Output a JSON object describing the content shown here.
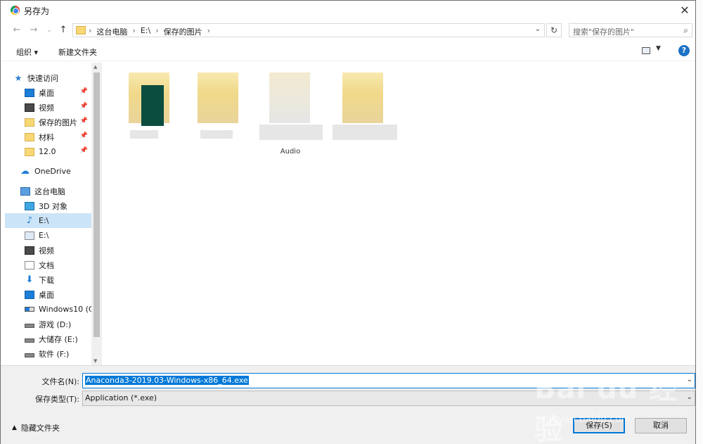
{
  "window": {
    "title": "另存为",
    "close_label": "✕"
  },
  "address": {
    "crumbs": [
      "这台电脑",
      "E:\\",
      "保存的图片"
    ],
    "search_placeholder": "搜索\"保存的图片\""
  },
  "toolbar": {
    "organize": "组织 ▾",
    "new_folder": "新建文件夹",
    "help": "?"
  },
  "nav": {
    "quick_access": "快速访问",
    "quick_items": [
      {
        "label": "桌面",
        "icon": "desktop-icon"
      },
      {
        "label": "视频",
        "icon": "video-icon"
      },
      {
        "label": "保存的图片",
        "icon": "folder-icon"
      },
      {
        "label": "材料",
        "icon": "folder-icon"
      },
      {
        "label": "12.0",
        "icon": "folder-icon"
      }
    ],
    "onedrive": "OneDrive",
    "this_pc": "这台电脑",
    "pc_items": [
      {
        "label": "3D 对象",
        "icon": "3d-objects-icon"
      },
      {
        "label": "E:\\",
        "icon": "music-icon",
        "selected": true
      },
      {
        "label": "E:\\",
        "icon": "image-icon"
      },
      {
        "label": "视频",
        "icon": "video-icon"
      },
      {
        "label": "文档",
        "icon": "document-icon"
      },
      {
        "label": "下载",
        "icon": "download-icon"
      },
      {
        "label": "桌面",
        "icon": "desktop-icon"
      },
      {
        "label": "Windows10 (C:",
        "icon": "windows-drive-icon"
      },
      {
        "label": "游戏 (D:)",
        "icon": "drive-icon"
      },
      {
        "label": "大储存 (E:)",
        "icon": "drive-icon"
      },
      {
        "label": "软件 (F:)",
        "icon": "drive-icon"
      }
    ]
  },
  "files": [
    {
      "caption": ""
    },
    {
      "caption": ""
    },
    {
      "caption": "Audio"
    },
    {
      "caption": ""
    }
  ],
  "footer": {
    "filename_label": "文件名(N):",
    "filename_value": "Anaconda3-2019.03-Windows-x86_64.exe",
    "type_label": "保存类型(T):",
    "type_value": "Application (*.exe)",
    "hide_folders": "隐藏文件夹",
    "save": "保存(S)",
    "cancel": "取消"
  },
  "watermark": {
    "brand": "Bai du 经验",
    "url": "jingyan.baidu.com"
  }
}
